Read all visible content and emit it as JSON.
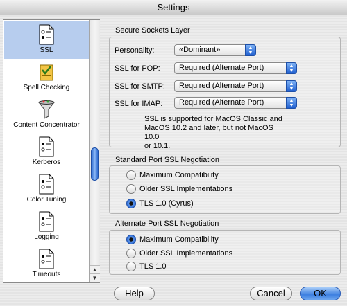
{
  "window": {
    "title": "Settings"
  },
  "sidebar": {
    "items": [
      {
        "label": "SSL",
        "icon": "ssl-icon",
        "selected": true
      },
      {
        "label": "Spell Checking",
        "icon": "spell-checking-icon",
        "selected": false
      },
      {
        "label": "Content Concentrator",
        "icon": "content-concentrator-icon",
        "selected": false
      },
      {
        "label": "Kerberos",
        "icon": "kerberos-icon",
        "selected": false
      },
      {
        "label": "Color Tuning",
        "icon": "color-tuning-icon",
        "selected": false
      },
      {
        "label": "Logging",
        "icon": "logging-icon",
        "selected": false
      },
      {
        "label": "Timeouts",
        "icon": "timeouts-icon",
        "selected": false
      }
    ]
  },
  "ssl_group": {
    "title": "Secure Sockets Layer",
    "personality_label": "Personality:",
    "personality_value": "«Dominant»",
    "pop_label": "SSL for POP:",
    "pop_value": "Required (Alternate Port)",
    "smtp_label": "SSL for SMTP:",
    "smtp_value": "Required (Alternate Port)",
    "imap_label": "SSL for IMAP:",
    "imap_value": "Required (Alternate Port)",
    "note_line1": "SSL is supported for MacOS Classic and",
    "note_line2": "MacOS 10.2 and later, but not MacOS 10.0",
    "note_line3": "or 10.1."
  },
  "standard_group": {
    "title": "Standard Port SSL Negotiation",
    "options": [
      "Maximum Compatibility",
      "Older SSL Implementations",
      "TLS 1.0 (Cyrus)"
    ],
    "selected_index": 2
  },
  "alternate_group": {
    "title": "Alternate Port SSL Negotiation",
    "options": [
      "Maximum Compatibility",
      "Older SSL Implementations",
      "TLS 1.0"
    ],
    "selected_index": 0
  },
  "buttons": {
    "help": "Help",
    "cancel": "Cancel",
    "ok": "OK"
  },
  "colors": {
    "accent": "#3d7fe0",
    "selection": "#b7cdee"
  }
}
